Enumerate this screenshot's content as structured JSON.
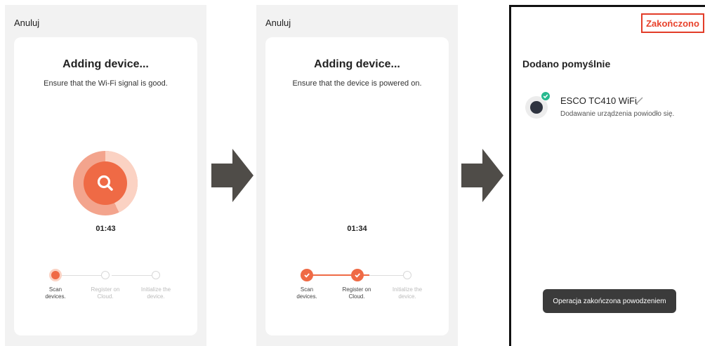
{
  "screen1": {
    "cancel_label": "Anuluj",
    "title": "Adding device...",
    "subtitle": "Ensure that the Wi-Fi signal is good.",
    "timer": "01:43",
    "steps": [
      {
        "line1": "Scan",
        "line2": "devices.",
        "state": "current"
      },
      {
        "line1": "Register on",
        "line2": "Cloud.",
        "state": "pending"
      },
      {
        "line1": "Initialize the",
        "line2": "device.",
        "state": "pending"
      }
    ]
  },
  "screen2": {
    "cancel_label": "Anuluj",
    "title": "Adding device...",
    "subtitle": "Ensure that the device is powered on.",
    "timer": "01:34",
    "steps": [
      {
        "line1": "Scan",
        "line2": "devices.",
        "state": "done"
      },
      {
        "line1": "Register on",
        "line2": "Cloud.",
        "state": "done"
      },
      {
        "line1": "Initialize the",
        "line2": "device.",
        "state": "pending"
      }
    ]
  },
  "screen3": {
    "done_label": "Zakończono",
    "added_title": "Dodano pomyślnie",
    "device_name": "ESCO TC410 WiFi",
    "device_status": "Dodawanie urządzenia powiodło się.",
    "toast": "Operacja zakończona powodzeniem"
  },
  "icons": {
    "search": "search-icon",
    "check": "check-icon",
    "edit": "pencil-icon",
    "arrow": "right-arrow-icon"
  },
  "colors": {
    "accent": "#ef6a45",
    "accent_light": "#fbd2c3",
    "success": "#28b98f",
    "done_border": "#e23c28",
    "arrow": "#4f4c48"
  }
}
